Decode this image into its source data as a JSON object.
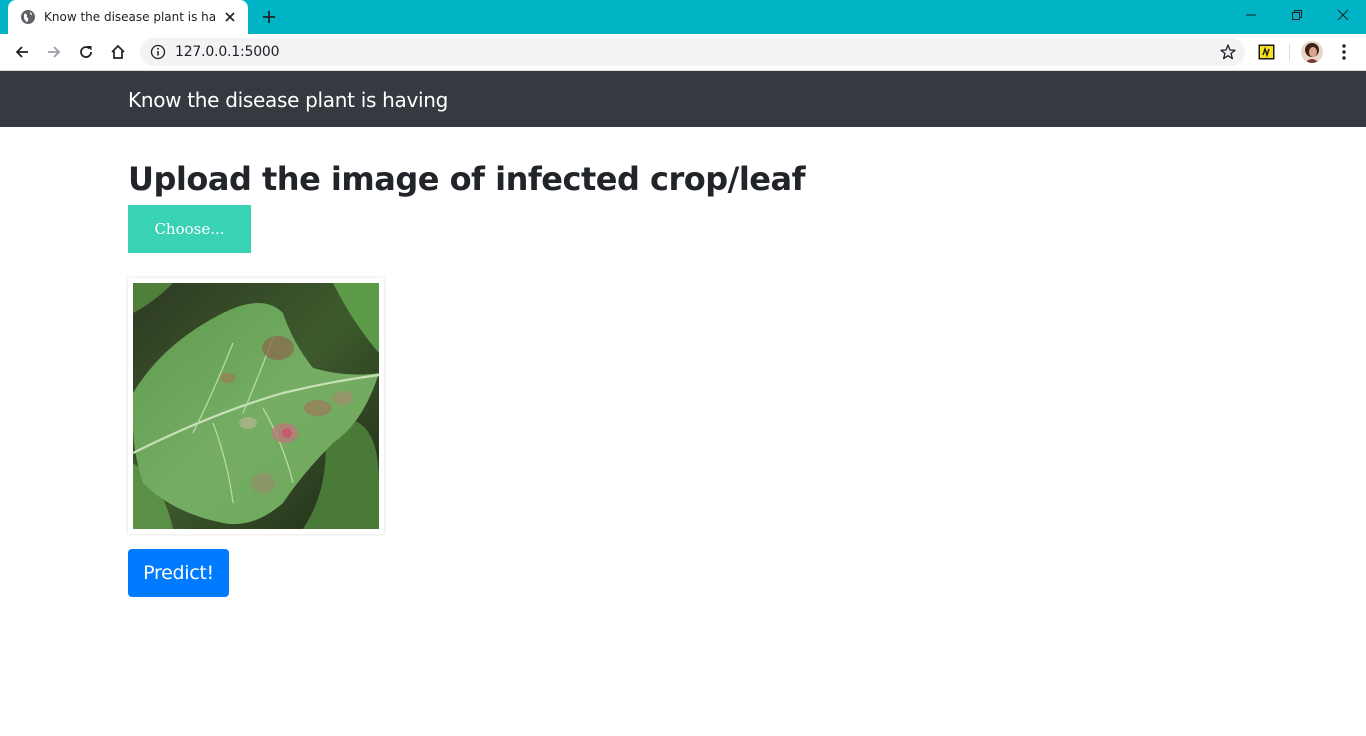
{
  "browser": {
    "tab_title": "Know the disease plant is having",
    "url": "127.0.0.1:5000",
    "accent_color": "#00b4c5"
  },
  "navbar": {
    "brand": "Know the disease plant is having",
    "background": "#343a40"
  },
  "main": {
    "heading": "Upload the image of infected crop/leaf",
    "choose_label": "Choose...",
    "choose_color": "#39d2b4",
    "preview_image": "leaf-photo",
    "predict_label": "Predict!",
    "predict_color": "#007bff"
  },
  "icons": [
    "globe-icon",
    "close-icon",
    "plus-icon",
    "minimize-icon",
    "restore-icon",
    "window-close-icon",
    "back-icon",
    "forward-icon",
    "reload-icon",
    "home-icon",
    "info-icon",
    "star-icon",
    "extension-icon",
    "avatar",
    "menu-icon"
  ]
}
